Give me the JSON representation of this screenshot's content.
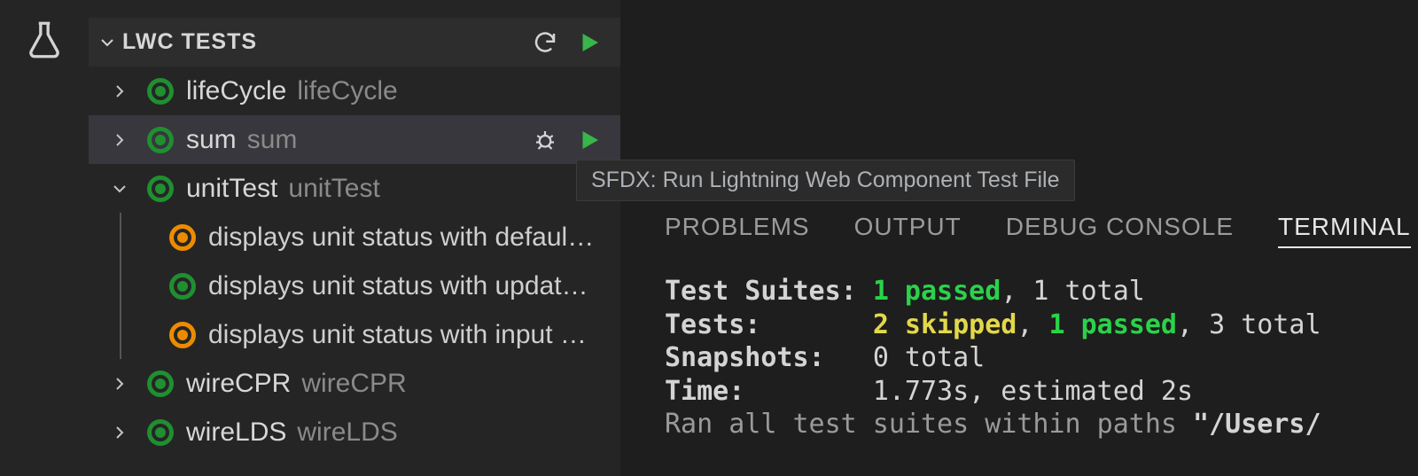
{
  "sidebar": {
    "title": "LWC TESTS",
    "items": [
      {
        "name": "lifeCycle",
        "desc": "lifeCycle",
        "status": "green",
        "expanded": false,
        "selected": false
      },
      {
        "name": "sum",
        "desc": "sum",
        "status": "green",
        "expanded": false,
        "selected": true
      },
      {
        "name": "unitTest",
        "desc": "unitTest",
        "status": "green",
        "expanded": true,
        "selected": false,
        "children": [
          {
            "label": "displays unit status with defaul…",
            "status": "orange"
          },
          {
            "label": "displays unit status with updat…",
            "status": "green"
          },
          {
            "label": "displays unit status with input …",
            "status": "orange"
          }
        ]
      },
      {
        "name": "wireCPR",
        "desc": "wireCPR",
        "status": "green",
        "expanded": false,
        "selected": false
      },
      {
        "name": "wireLDS",
        "desc": "wireLDS",
        "status": "green",
        "expanded": false,
        "selected": false
      }
    ]
  },
  "tooltip": "SFDX: Run Lightning Web Component Test File",
  "panel_tabs": {
    "problems": "PROBLEMS",
    "output": "OUTPUT",
    "debug": "DEBUG CONSOLE",
    "terminal": "TERMINAL"
  },
  "terminal": {
    "line1_label": "Test Suites: ",
    "line1_passed": "1 passed",
    "line1_rest": ", 1 total",
    "line2_label": "Tests:       ",
    "line2_skipped": "2 skipped",
    "line2_sep": ", ",
    "line2_passed": "1 passed",
    "line2_rest": ", 3 total",
    "line3_label": "Snapshots:   ",
    "line3_rest": "0 total",
    "line4_label": "Time:        ",
    "line4_rest": "1.773s, estimated 2s",
    "line5_a": "Ran all test suites within paths ",
    "line5_b": "\"/Users/"
  }
}
